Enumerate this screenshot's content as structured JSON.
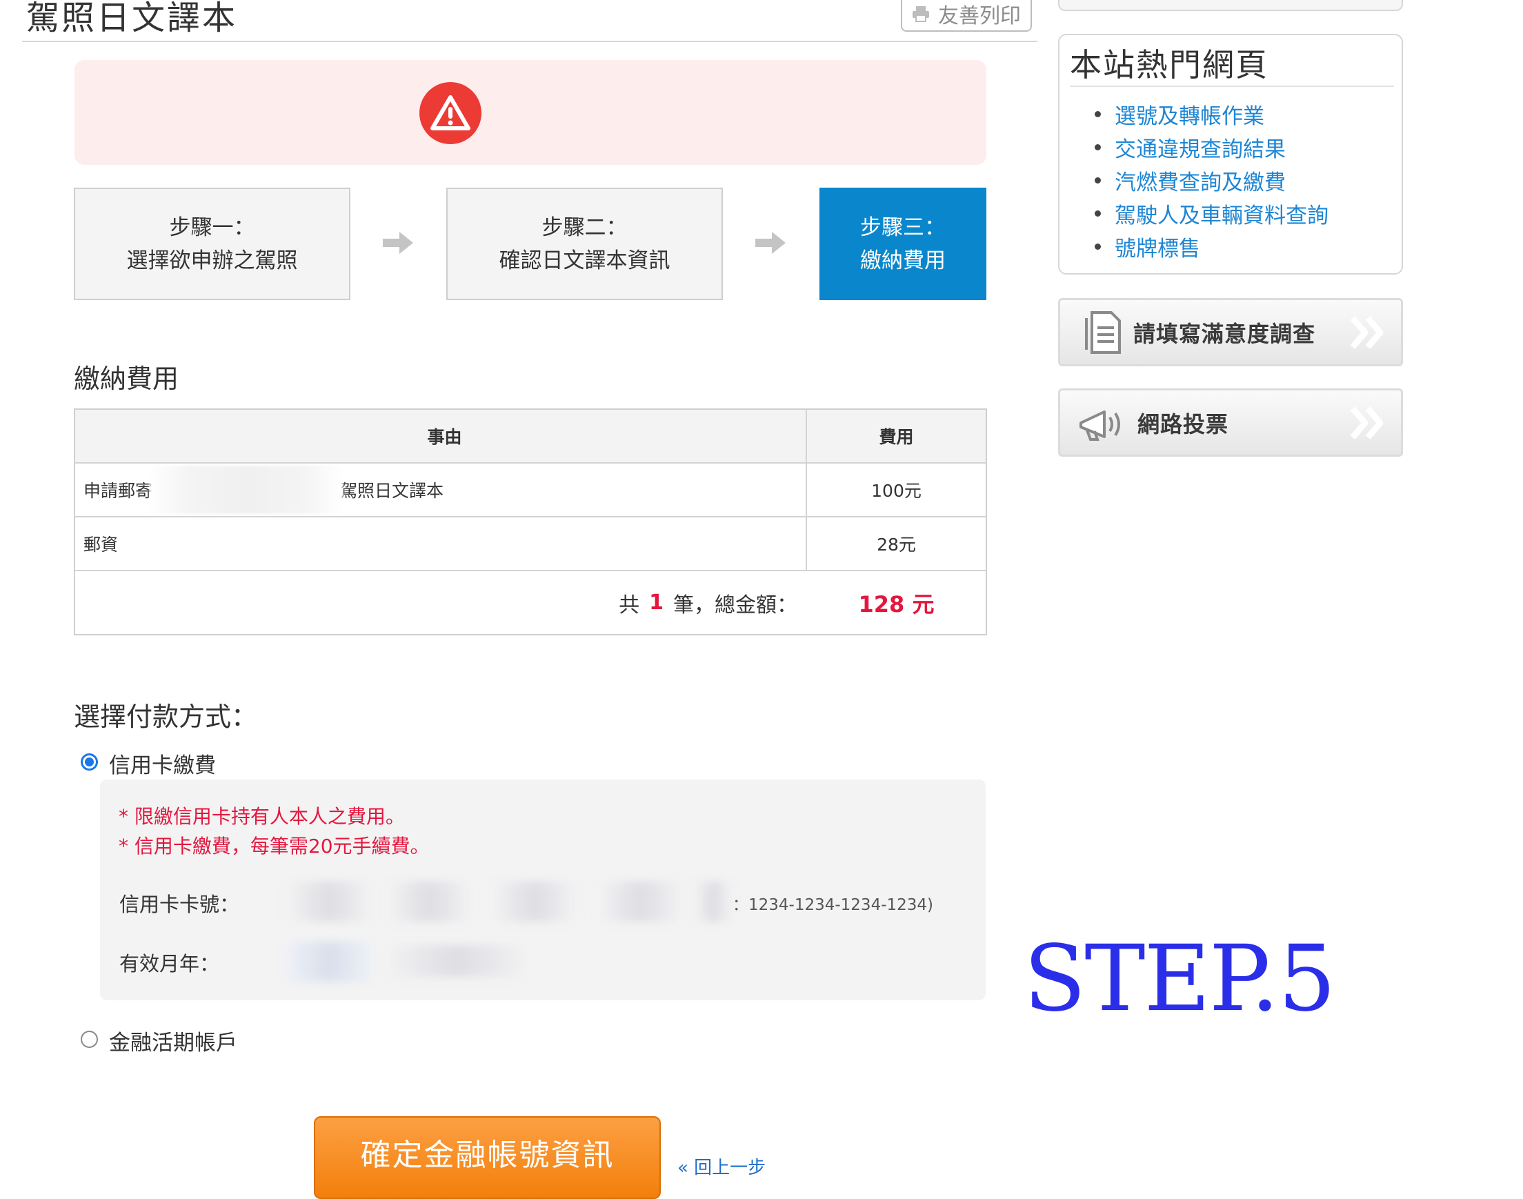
{
  "page": {
    "title": "駕照日文譯本",
    "print_label": "友善列印"
  },
  "steps": [
    {
      "line1": "步驟一：",
      "line2": "選擇欲申辦之駕照"
    },
    {
      "line1": "步驟二：",
      "line2": "確認日文譯本資訊"
    },
    {
      "line1": "步驟三：",
      "line2": "繳納費用"
    }
  ],
  "fee": {
    "heading": "繳納費用",
    "col_reason": "事由",
    "col_fee": "費用",
    "rows": [
      {
        "reason_prefix": "申請郵寄",
        "reason_suffix": "駕照日文譯本",
        "fee": "100元"
      },
      {
        "reason_prefix": "郵資",
        "reason_suffix": "",
        "fee": "28元"
      }
    ],
    "total_prefix": "共",
    "total_count": "1",
    "total_middle": "筆，總金額：",
    "total_amount": "128 元"
  },
  "payment": {
    "heading": "選擇付款方式：",
    "option_credit": "信用卡繳費",
    "note1": "* 限繳信用卡持有人本人之費用。",
    "note2": "* 信用卡繳費，每筆需20元手續費。",
    "card_label": "信用卡卡號：",
    "card_hint": "：1234-1234-1234-1234)",
    "expiry_label": "有效月年：",
    "option_bank": "金融活期帳戶",
    "submit_label": "確定金融帳號資訊",
    "back_label": "« 回上一步"
  },
  "sidebar": {
    "hot_title": "本站熱門網頁",
    "hot_links": [
      "選號及轉帳作業",
      "交通違規查詢結果",
      "汽燃費查詢及繳費",
      "駕駛人及車輛資料查詢",
      "號牌標售"
    ],
    "survey_label": "請填寫滿意度調查",
    "vote_label": "網路投票"
  },
  "annotation": {
    "step_text": "STEP.5"
  },
  "colors": {
    "accent_blue": "#0a87cc",
    "alert_red": "#ec3a34",
    "link_blue": "#1e86d4",
    "amount_red": "#e3173e",
    "button_orange": "#f37f0c",
    "annotation_blue": "#2b2ee8"
  }
}
